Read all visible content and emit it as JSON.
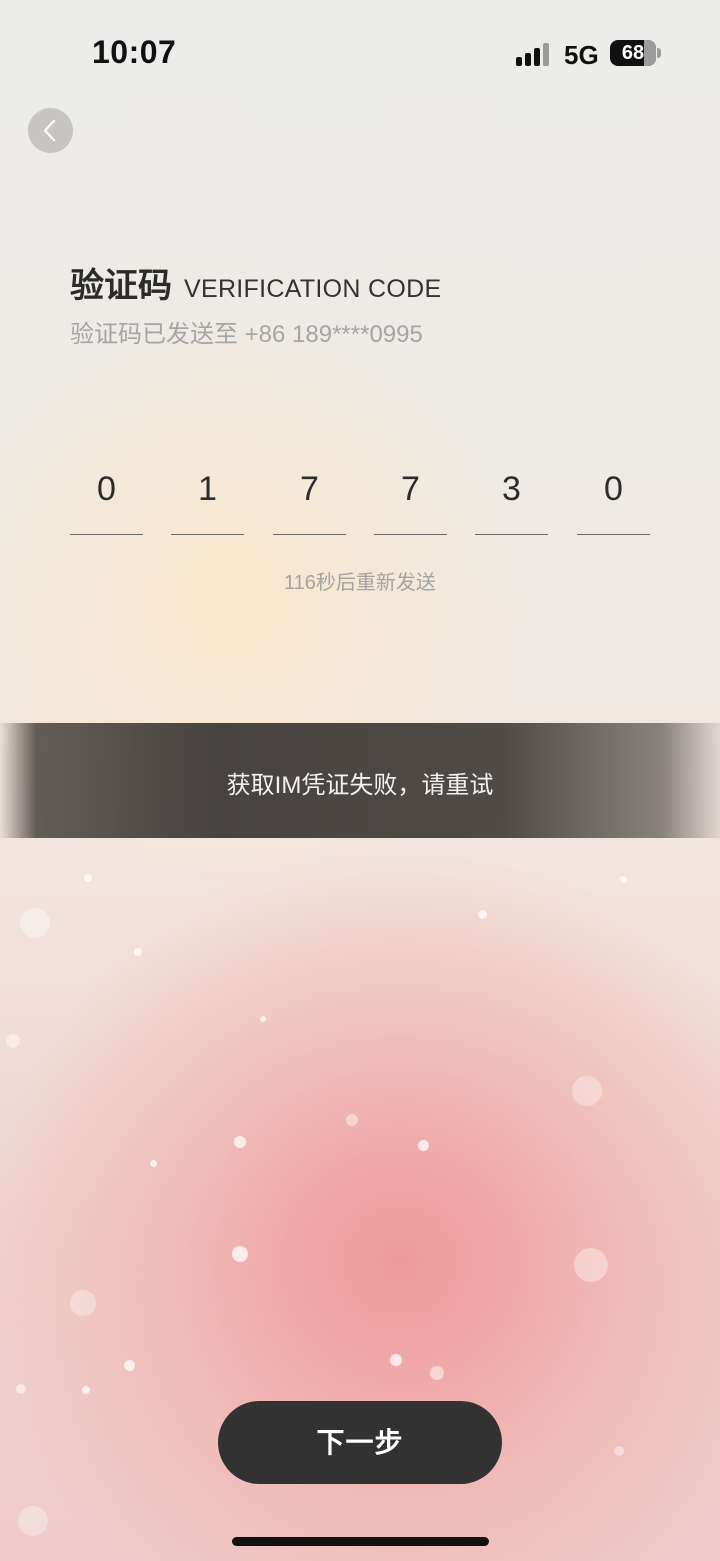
{
  "status_bar": {
    "time": "10:07",
    "network": "5G",
    "battery": "68",
    "signal_icon": "cellular-signal-icon",
    "battery_icon": "battery-icon"
  },
  "back_icon": "chevron-left-icon",
  "header": {
    "title_cn": "验证码",
    "title_en": "VERIFICATION CODE",
    "sent_to": "验证码已发送至 +86 189****0995"
  },
  "code": {
    "digits": [
      "0",
      "1",
      "7",
      "7",
      "3",
      "0"
    ]
  },
  "resend": {
    "text": "116秒后重新发送"
  },
  "toast": {
    "message": "获取IM凭证失败，请重试"
  },
  "next_button": {
    "label": "下一步"
  },
  "colors": {
    "button_background": "#333232",
    "toast_background": "#3e3a38",
    "muted_text": "#a5a5a5"
  }
}
